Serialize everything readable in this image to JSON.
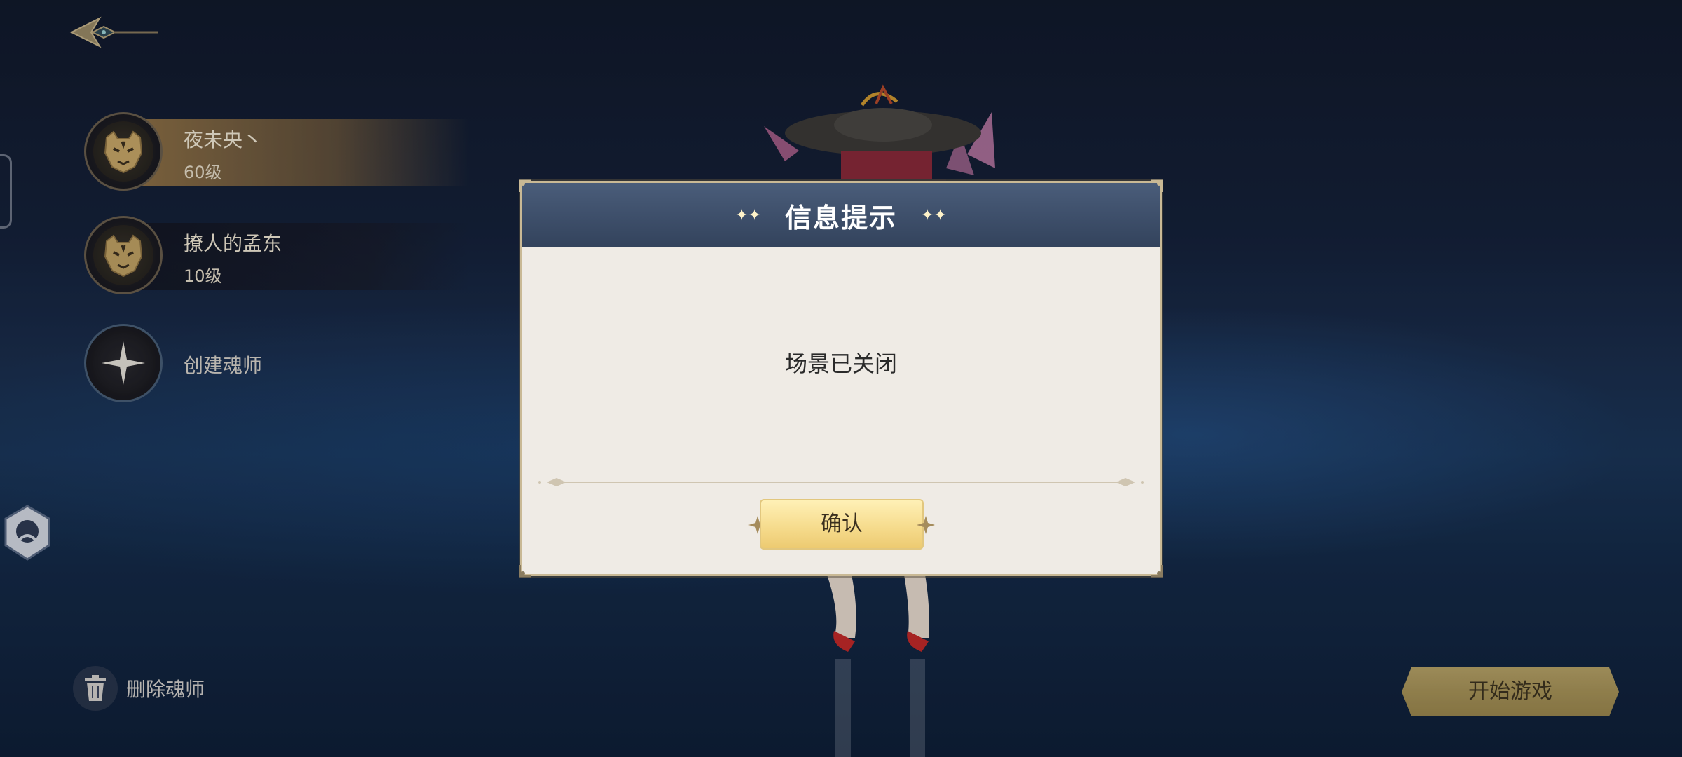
{
  "characters": [
    {
      "name": "夜未央丶",
      "level": "60级",
      "selected": true
    },
    {
      "name": "撩人的孟东",
      "level": "10级",
      "selected": false
    }
  ],
  "create_label": "创建魂师",
  "delete_label": "删除魂师",
  "start_label": "开始游戏",
  "dialog": {
    "title": "信息提示",
    "message": "场景已关闭",
    "confirm_label": "确认"
  },
  "icons": {
    "back": "back-arrow-icon",
    "avatar": "tiger-head-icon",
    "create": "four-point-star-icon",
    "delete": "trash-icon",
    "side": "hooded-figure-icon",
    "sparkle": "sparkle-icon"
  },
  "colors": {
    "selected_row": "#96764a",
    "dialog_header": "#3c4d68",
    "dialog_body": "#efebe5",
    "confirm_button": "#f6dc8e",
    "start_button": "#a89459"
  }
}
